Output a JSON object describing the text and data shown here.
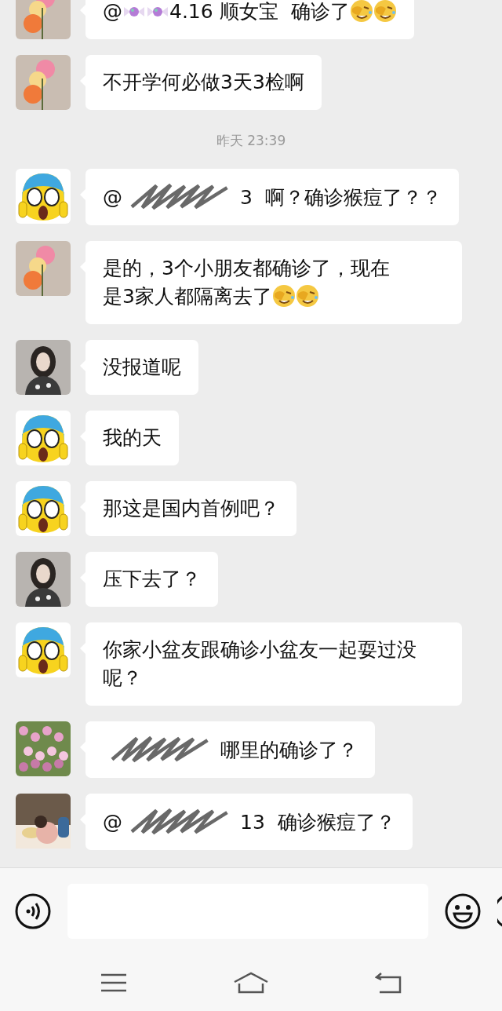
{
  "messages": [
    {
      "kind": "message",
      "avatar": {
        "kind": "flowers"
      },
      "segments": [
        {
          "kind": "text",
          "text": "@"
        },
        {
          "kind": "candy"
        },
        {
          "kind": "candy"
        },
        {
          "kind": "text",
          "text": "4.16 顺女宝  确诊了"
        },
        {
          "kind": "facepalm"
        },
        {
          "kind": "facepalm"
        }
      ]
    },
    {
      "kind": "message",
      "avatar": {
        "kind": "flowers"
      },
      "segments": [
        {
          "kind": "text",
          "text": "不开学何必做3天3检啊"
        }
      ]
    },
    {
      "kind": "time",
      "text": "昨天 23:39"
    },
    {
      "kind": "message",
      "avatar": {
        "kind": "scream"
      },
      "segments": [
        {
          "kind": "text",
          "text": "@"
        },
        {
          "kind": "redaction"
        },
        {
          "kind": "text",
          "text": "3  啊？确诊猴痘了？？"
        }
      ]
    },
    {
      "kind": "message",
      "avatar": {
        "kind": "flowers"
      },
      "segments": [
        {
          "kind": "text",
          "text": "是的，3个小朋友都确诊了，现在"
        },
        {
          "kind": "text",
          "text": "是3家人都隔离去了"
        },
        {
          "kind": "facepalm"
        },
        {
          "kind": "facepalm"
        }
      ]
    },
    {
      "kind": "message",
      "avatar": {
        "kind": "portrait"
      },
      "segments": [
        {
          "kind": "text",
          "text": "没报道呢"
        }
      ]
    },
    {
      "kind": "message",
      "avatar": {
        "kind": "scream"
      },
      "segments": [
        {
          "kind": "text",
          "text": "我的天"
        }
      ]
    },
    {
      "kind": "message",
      "avatar": {
        "kind": "scream"
      },
      "segments": [
        {
          "kind": "text",
          "text": "那这是国内首例吧？"
        }
      ]
    },
    {
      "kind": "message",
      "avatar": {
        "kind": "portrait"
      },
      "segments": [
        {
          "kind": "text",
          "text": "压下去了？"
        }
      ]
    },
    {
      "kind": "message",
      "avatar": {
        "kind": "scream"
      },
      "segments": [
        {
          "kind": "text",
          "text": "你家小盆友跟确诊小盆友一起耍过没呢？"
        }
      ]
    },
    {
      "kind": "message",
      "avatar": {
        "kind": "meadow"
      },
      "segments": [
        {
          "kind": "redaction"
        },
        {
          "kind": "text",
          "text": "哪里的确诊了？"
        }
      ]
    },
    {
      "kind": "message",
      "avatar": {
        "kind": "child"
      },
      "segments": [
        {
          "kind": "text",
          "text": "@"
        },
        {
          "kind": "redaction"
        },
        {
          "kind": "text",
          "text": "13  确诊猴痘了？"
        }
      ]
    }
  ]
}
